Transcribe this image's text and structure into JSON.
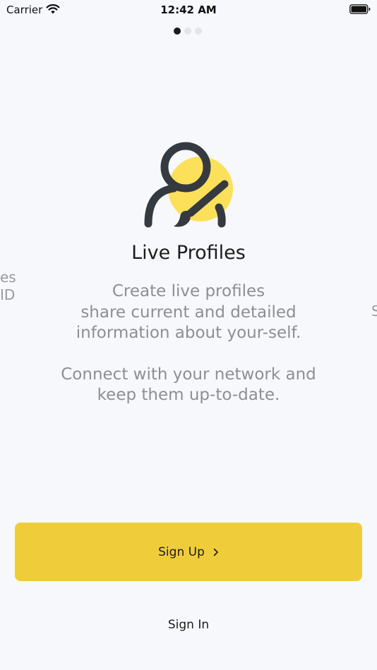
{
  "status_bar": {
    "carrier": "Carrier",
    "time": "12:42 AM",
    "icons": [
      "wifi-icon",
      "battery-icon"
    ]
  },
  "pager": {
    "total": 3,
    "current": 1
  },
  "peek": {
    "left_line1": "es",
    "left_line2": "ID",
    "right_line": "S"
  },
  "onboarding": {
    "illustration_icon": "user-edit-icon",
    "title": "Live Profiles",
    "description_1": "Create live profiles\nshare current and detailed\ninformation about your-self.",
    "description_2": "Connect with your network and\nkeep them up-to-date."
  },
  "actions": {
    "signup_label": "Sign Up",
    "signup_icon": "chevron-right-icon",
    "signin_label": "Sign In"
  },
  "colors": {
    "background": "#f7f8fc",
    "accent": "#efcd3a",
    "illustration_yellow": "#fde05a",
    "illustration_dark": "#343a40",
    "muted_text": "#8e8e93"
  }
}
